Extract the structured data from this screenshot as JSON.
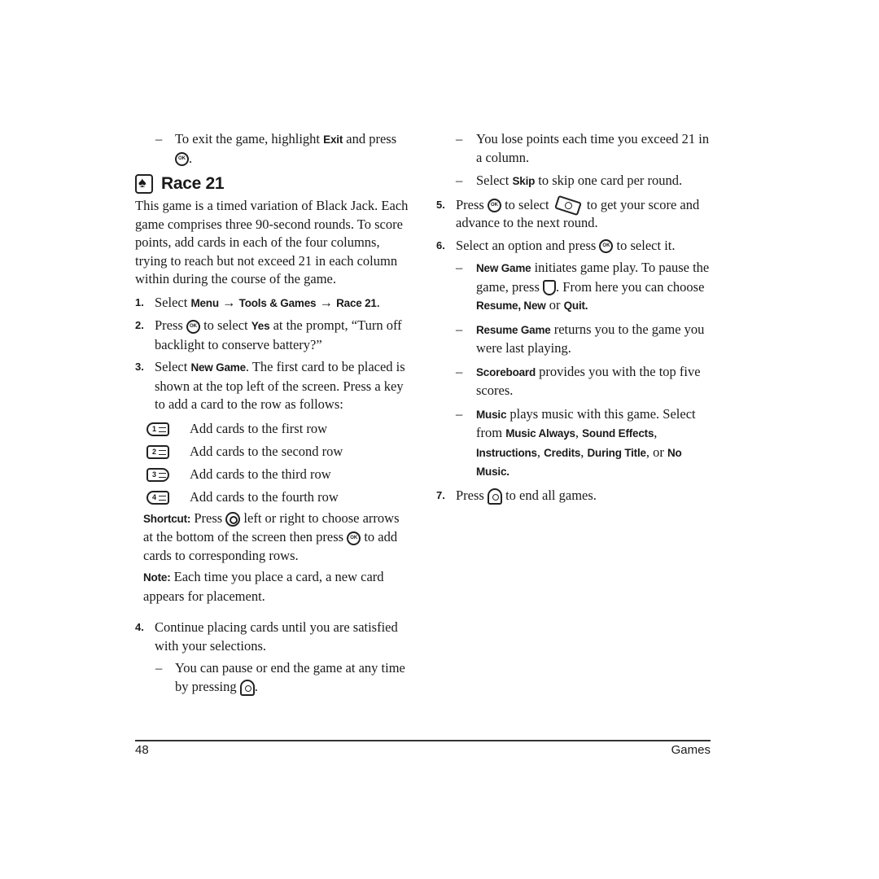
{
  "left_column": {
    "exit_bullet": {
      "dash": "–",
      "text_1": "To exit the game, highlight",
      "bold": "Exit",
      "text_2": "and press",
      "end": "."
    },
    "heading": {
      "icon": "spade-card-icon",
      "title": "Race 21"
    },
    "intro": "This game is a timed variation of Black Jack. Each game comprises three 90-second rounds. To score points, add cards in each of the four columns, trying to reach but not exceed 21 in each column within during the course of the game.",
    "steps": [
      {
        "num": "1.",
        "text_1": "Select",
        "b1": "Menu",
        "arrow": "→",
        "b2": "Tools & Games",
        "b3": "Race 21",
        "end": "."
      },
      {
        "num": "2.",
        "text_1": "Press",
        "text_2": "to select",
        "bold": "Yes",
        "text_3": "at the prompt, “Turn off backlight to conserve battery?”"
      },
      {
        "num": "3.",
        "text_1": "Select",
        "bold": "New Game",
        "text_2": ". The first card to be placed is shown at the top left of the screen. Press a key to add a card to the row as follows:"
      }
    ],
    "key_table": [
      {
        "key": "1",
        "icon": "key-1-icon",
        "desc": "Add cards to the first row"
      },
      {
        "key": "2",
        "icon": "key-2-icon",
        "desc": "Add cards to the second row"
      },
      {
        "key": "3",
        "icon": "key-3-icon",
        "desc": "Add cards to the third row"
      },
      {
        "key": "4",
        "icon": "key-4-icon",
        "desc": "Add cards to the fourth row"
      }
    ],
    "shortcut": {
      "label": "Shortcut:",
      "text_1": "Press",
      "text_2": "left or right to choose arrows at the bottom of the screen then press",
      "text_3": "to add cards to corresponding rows."
    },
    "note": {
      "label": "Note:",
      "text": "Each time you place a card, a new card appears for placement."
    },
    "step4": {
      "num": "4.",
      "text": "Continue placing cards until you are satisfied with your selections."
    },
    "pause_bullet": {
      "dash": "–",
      "text": "You can pause or end the game at any time by pressing",
      "end": "."
    }
  },
  "right_column": {
    "bullets_top": [
      {
        "dash": "–",
        "text": "You lose points each time you exceed 21 in a column."
      },
      {
        "dash": "–",
        "text_1": "Select",
        "bold": "Skip",
        "text_2": "to skip one card per round."
      }
    ],
    "step5": {
      "num": "5.",
      "text_1": "Press",
      "text_2": "to select",
      "text_3": "to get your score and advance to the next round."
    },
    "step6": {
      "num": "6.",
      "text_1": "Select an option and press",
      "text_2": "to select it."
    },
    "options": [
      {
        "dash": "–",
        "bold": "New Game",
        "text_1": "initiates game play. To pause the game, press",
        "text_2": ". From here you can choose",
        "b2": "Resume, New",
        "text_3": "or",
        "b3": "Quit."
      },
      {
        "dash": "–",
        "bold": "Resume Game",
        "text": "returns you to the game you were last playing."
      },
      {
        "dash": "–",
        "bold": "Scoreboard",
        "text": "provides you with the top five scores."
      },
      {
        "dash": "–",
        "bold": "Music",
        "text_1": "plays music with this game. Select from",
        "b2": "Music Always",
        "b3": "Sound Effects",
        "b4": "Instructions",
        "b5": "Credits",
        "b6": "During Title",
        "text_2": "or",
        "b7": "No Music."
      }
    ],
    "step7": {
      "num": "7.",
      "text_1": "Press",
      "text_2": "to end all games."
    }
  },
  "footer": {
    "page_number": "48",
    "section": "Games"
  }
}
